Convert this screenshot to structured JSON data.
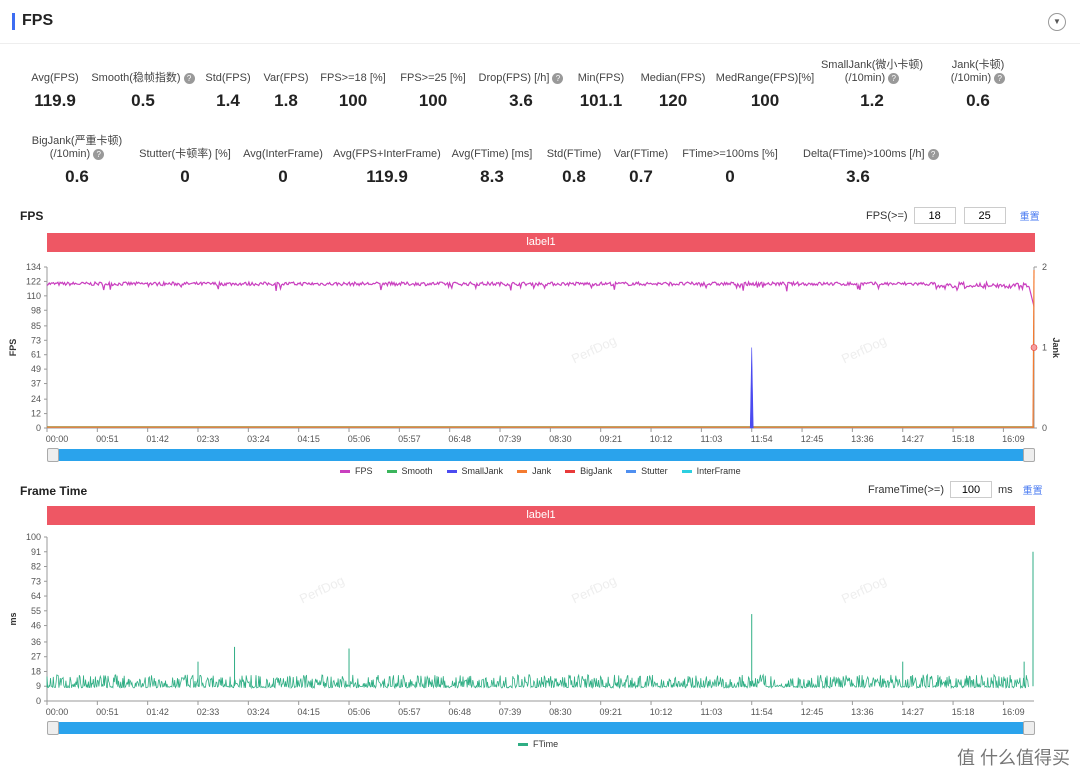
{
  "header": {
    "title": "FPS",
    "dropdown_icon": "caret-down-icon"
  },
  "metrics_row1": [
    {
      "label": "Avg(FPS)",
      "value": "119.9"
    },
    {
      "label": "Smooth(稳帧指数)",
      "value": "0.5",
      "help": true
    },
    {
      "label": "Std(FPS)",
      "value": "1.4"
    },
    {
      "label": "Var(FPS)",
      "value": "1.8"
    },
    {
      "label": "FPS>=18 [%]",
      "value": "100"
    },
    {
      "label": "FPS>=25 [%]",
      "value": "100"
    },
    {
      "label": "Drop(FPS) [/h]",
      "value": "3.6",
      "help": true
    },
    {
      "label": "Min(FPS)",
      "value": "101.1"
    },
    {
      "label": "Median(FPS)",
      "value": "120"
    },
    {
      "label": "MedRange(FPS)[%]",
      "value": "100"
    },
    {
      "label": "SmallJank(微小卡顿)",
      "label2": "(/10min)",
      "value": "1.2",
      "help": true
    },
    {
      "label": "Jank(卡顿)",
      "label2": "(/10min)",
      "value": "0.6",
      "help": true
    }
  ],
  "metrics_row2": [
    {
      "label": "BigJank(严重卡顿)",
      "label2": "(/10min)",
      "value": "0.6",
      "help": true
    },
    {
      "label": "Stutter(卡顿率) [%]",
      "value": "0"
    },
    {
      "label": "Avg(InterFrame)",
      "value": "0"
    },
    {
      "label": "Avg(FPS+InterFrame)",
      "value": "119.9"
    },
    {
      "label": "Avg(FTime) [ms]",
      "value": "8.3"
    },
    {
      "label": "Std(FTime)",
      "value": "0.8"
    },
    {
      "label": "Var(FTime)",
      "value": "0.7"
    },
    {
      "label": "FTime>=100ms [%]",
      "value": "0"
    },
    {
      "label": "Delta(FTime)>100ms [/h]",
      "value": "3.6",
      "help": true
    }
  ],
  "fps_section": {
    "title": "FPS",
    "threshold_label": "FPS(>=)",
    "threshold1": "18",
    "threshold2": "25",
    "reset": "重置",
    "band_label": "label1"
  },
  "ft_section": {
    "title": "Frame Time",
    "threshold_label": "FrameTime(>=)",
    "threshold": "100",
    "unit": "ms",
    "reset": "重置",
    "band_label": "label1"
  },
  "watermark": "PerfDog",
  "brand": "值 什么值得买",
  "colors": {
    "FPS": "#c93fbf",
    "Smooth": "#3bb55c",
    "SmallJank": "#4b4bf0",
    "Jank": "#f47b30",
    "BigJank": "#e83a3a",
    "Stutter": "#4f8ff0",
    "InterFrame": "#2ccfe0",
    "FTime": "#2fae84",
    "band": "#ee5764",
    "slider": "#2aa3ec"
  },
  "chart_data": [
    {
      "type": "line",
      "ylabel": "FPS",
      "y2label": "Jank",
      "yticks": [
        0,
        12,
        24,
        37,
        49,
        61,
        73,
        85,
        98,
        110,
        122,
        134
      ],
      "ylim": [
        0,
        134
      ],
      "y2ticks": [
        0,
        1,
        2
      ],
      "y2lim": [
        0,
        2
      ],
      "xticks": [
        "00:00",
        "00:51",
        "01:42",
        "02:33",
        "03:24",
        "04:15",
        "05:06",
        "05:57",
        "06:48",
        "07:39",
        "08:30",
        "09:21",
        "10:12",
        "11:03",
        "11:54",
        "12:45",
        "13:36",
        "14:27",
        "15:18",
        "16:09"
      ],
      "series": [
        {
          "name": "FPS",
          "axis": "left",
          "typical": 120,
          "min": 101.1,
          "range": [
            116,
            123
          ]
        },
        {
          "name": "Smooth",
          "axis": "right",
          "typical": 0
        },
        {
          "name": "SmallJank",
          "axis": "right",
          "typical": 0,
          "spikes": [
            {
              "x": "11:54",
              "y": 1
            }
          ]
        },
        {
          "name": "Jank",
          "axis": "right",
          "typical": 0,
          "spikes": [
            {
              "x": "16:40",
              "y": 2
            }
          ]
        },
        {
          "name": "BigJank",
          "axis": "right",
          "typical": 0,
          "spikes": [
            {
              "x": "16:40",
              "y": 1
            }
          ]
        },
        {
          "name": "Stutter",
          "axis": "right",
          "typical": 0
        },
        {
          "name": "InterFrame",
          "axis": "left",
          "typical": 0
        }
      ]
    },
    {
      "type": "line",
      "ylabel": "ms",
      "yticks": [
        0,
        9,
        18,
        27,
        36,
        46,
        55,
        64,
        73,
        82,
        91,
        100
      ],
      "ylim": [
        0,
        100
      ],
      "xticks": [
        "00:00",
        "00:51",
        "01:42",
        "02:33",
        "03:24",
        "04:15",
        "05:06",
        "05:57",
        "06:48",
        "07:39",
        "08:30",
        "09:21",
        "10:12",
        "11:03",
        "11:54",
        "12:45",
        "13:36",
        "14:27",
        "15:18",
        "16:09"
      ],
      "series": [
        {
          "name": "FTime",
          "typical": 8.3,
          "range": [
            8,
            16
          ],
          "spikes": [
            {
              "x": "02:33",
              "y": 24
            },
            {
              "x": "03:10",
              "y": 33
            },
            {
              "x": "05:06",
              "y": 32
            },
            {
              "x": "11:54",
              "y": 53
            },
            {
              "x": "14:27",
              "y": 24
            },
            {
              "x": "16:30",
              "y": 24
            },
            {
              "x": "16:40",
              "y": 91
            }
          ]
        }
      ]
    }
  ]
}
